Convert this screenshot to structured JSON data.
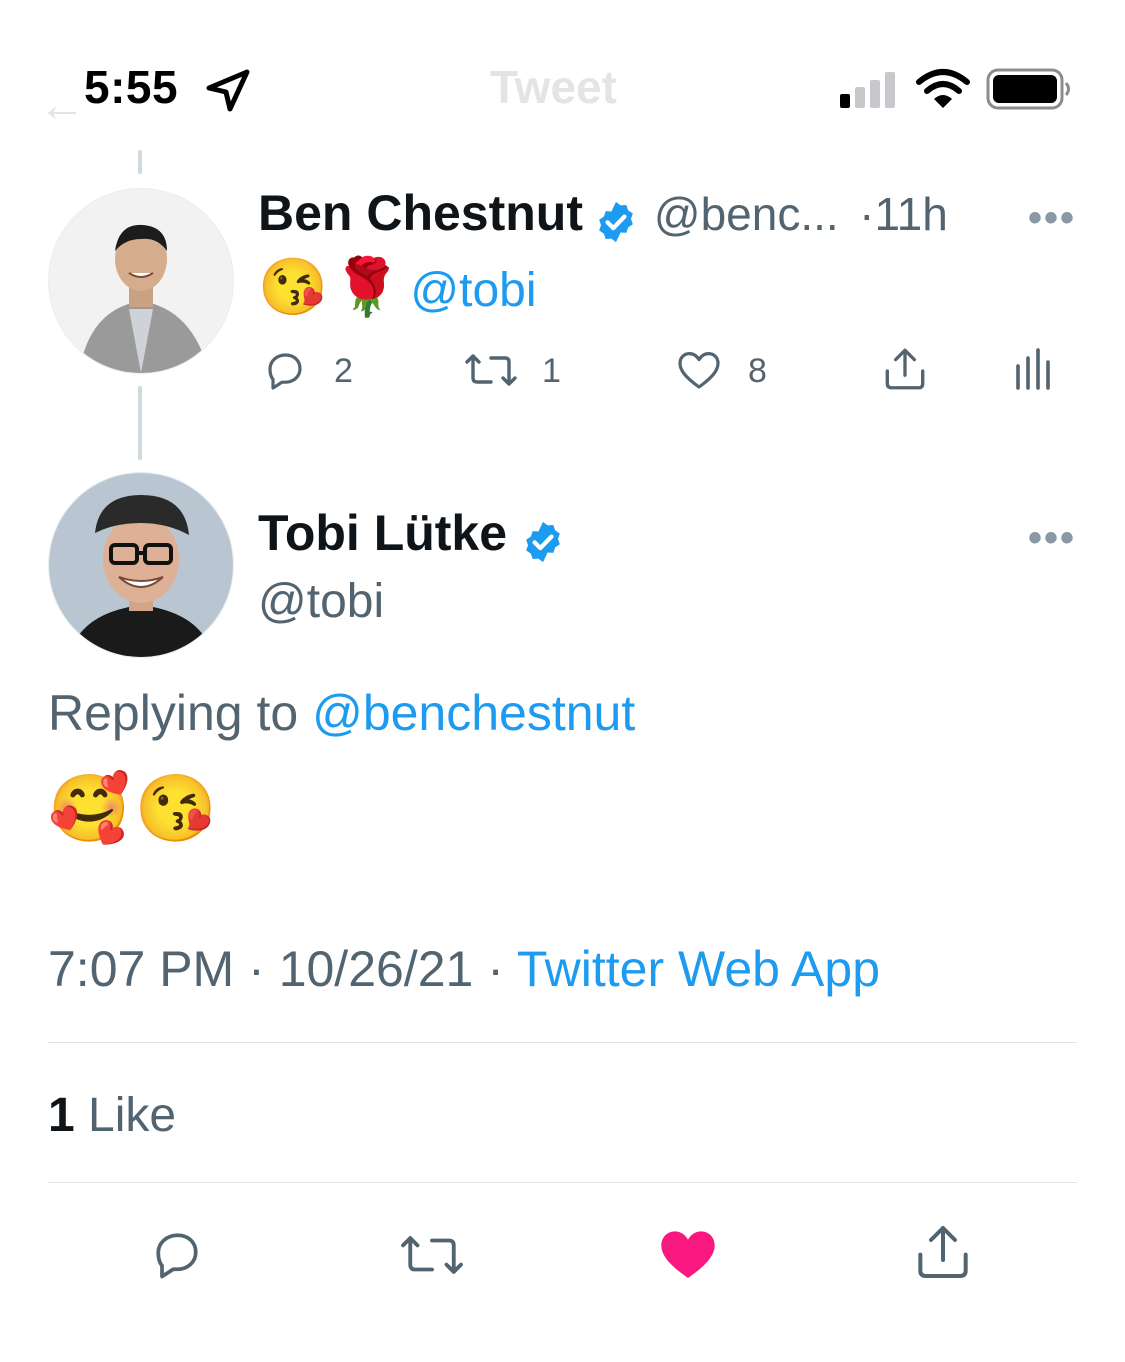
{
  "status_bar": {
    "time": "5:55"
  },
  "nav": {
    "title": "Tweet"
  },
  "parent_tweet": {
    "author_name": "Ben Chestnut",
    "handle": "@benc...",
    "time": "11h",
    "text_mention": "@tobi",
    "emojis": [
      "😘",
      "🌹"
    ],
    "counts": {
      "reply": "2",
      "retweet": "1",
      "like": "8"
    }
  },
  "main_tweet": {
    "author_name": "Tobi Lütke",
    "handle": "@tobi",
    "replying_prefix": "Replying to",
    "replying_handle": "@benchestnut",
    "emojis": [
      "🥰",
      "😘"
    ],
    "time": "7:07 PM",
    "date": "10/26/21",
    "source": "Twitter Web App",
    "sep": "·"
  },
  "stats": {
    "likes_count": "1",
    "likes_label": "Like"
  },
  "colors": {
    "accent": "#1d9bf0",
    "like": "#f91880",
    "muted": "#536471"
  }
}
